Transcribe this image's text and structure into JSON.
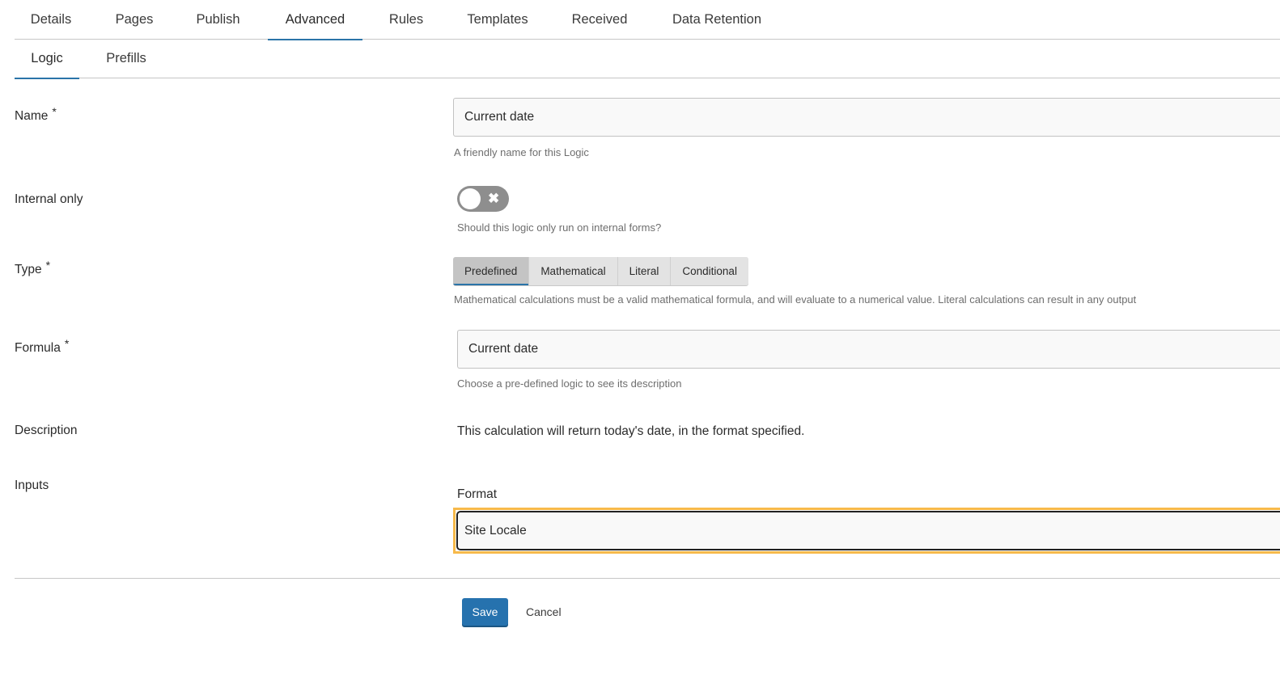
{
  "main_tabs": [
    {
      "label": "Details",
      "active": false
    },
    {
      "label": "Pages",
      "active": false
    },
    {
      "label": "Publish",
      "active": false
    },
    {
      "label": "Advanced",
      "active": true
    },
    {
      "label": "Rules",
      "active": false
    },
    {
      "label": "Templates",
      "active": false
    },
    {
      "label": "Received",
      "active": false
    },
    {
      "label": "Data Retention",
      "active": false
    }
  ],
  "sub_tabs": [
    {
      "label": "Logic",
      "active": true
    },
    {
      "label": "Prefills",
      "active": false
    }
  ],
  "form": {
    "name": {
      "label": "Name",
      "required_marker": "*",
      "value": "Current date",
      "help": "A friendly name for this Logic"
    },
    "internal_only": {
      "label": "Internal only",
      "state": "off",
      "off_icon": "x-icon",
      "help": "Should this logic only run on internal forms?"
    },
    "type": {
      "label": "Type",
      "required_marker": "*",
      "options": [
        "Predefined",
        "Mathematical",
        "Literal",
        "Conditional"
      ],
      "selected": "Predefined",
      "help": "Mathematical calculations must be a valid mathematical formula, and will evaluate to a numerical value. Literal calculations can result in any output"
    },
    "formula": {
      "label": "Formula",
      "required_marker": "*",
      "value": "Current date",
      "help": "Choose a pre-defined logic to see its description"
    },
    "description": {
      "label": "Description",
      "text": "This calculation will return today's date, in the format specified."
    },
    "inputs": {
      "label": "Inputs",
      "format_label": "Format",
      "format_value": "Site Locale"
    }
  },
  "actions": {
    "save_label": "Save",
    "cancel_label": "Cancel"
  },
  "colors": {
    "accent": "#2a74a8",
    "save_button": "#2672ae",
    "focus_ring": "#f7b94a",
    "toggle_off": "#8e8e8e"
  }
}
